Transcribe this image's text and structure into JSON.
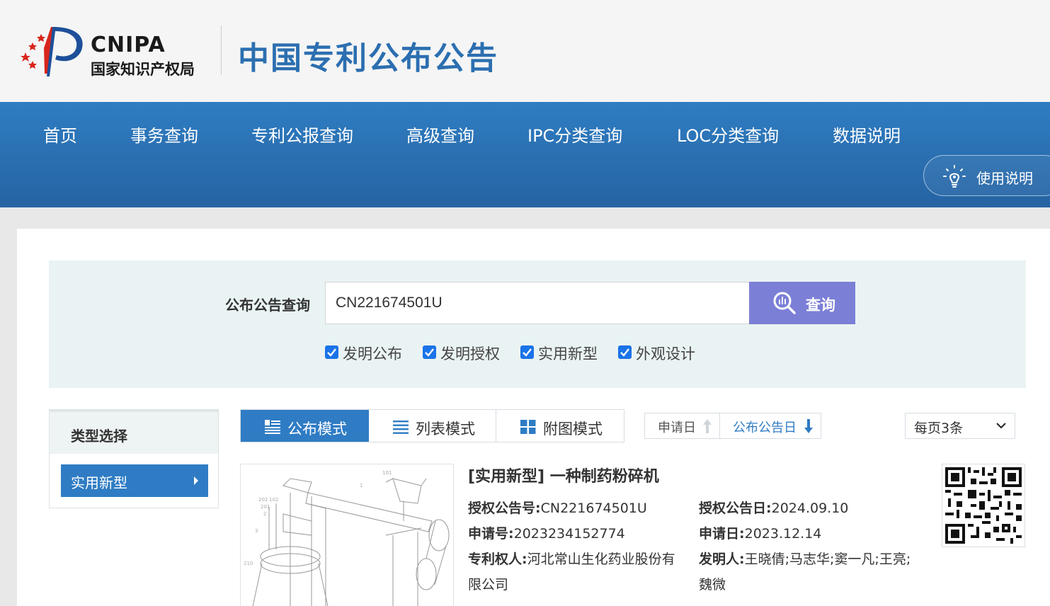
{
  "header": {
    "logo_en": "CNIPA",
    "logo_cn": "国家知识产权局",
    "site_title": "中国专利公布公告"
  },
  "nav": {
    "items": [
      {
        "label": "首页"
      },
      {
        "label": "事务查询"
      },
      {
        "label": "专利公报查询"
      },
      {
        "label": "高级查询"
      },
      {
        "label": "IPC分类查询"
      },
      {
        "label": "LOC分类查询"
      },
      {
        "label": "数据说明"
      }
    ],
    "help_label": "使用说明",
    "help_icon": "lightbulb-icon"
  },
  "search": {
    "label": "公布公告查询",
    "value": "CN221674501U",
    "button_label": "查询",
    "button_icon": "search-icon",
    "filters": [
      {
        "label": "发明公布",
        "checked": true
      },
      {
        "label": "发明授权",
        "checked": true
      },
      {
        "label": "实用新型",
        "checked": true
      },
      {
        "label": "外观设计",
        "checked": true
      }
    ]
  },
  "sidebar": {
    "title": "类型选择",
    "items": [
      {
        "label": "实用新型"
      }
    ]
  },
  "toolbar": {
    "tabs": [
      {
        "label": "公布模式",
        "icon": "publish-mode-icon",
        "active": true
      },
      {
        "label": "列表模式",
        "icon": "list-icon",
        "active": false
      },
      {
        "label": "附图模式",
        "icon": "grid-icon",
        "active": false
      }
    ],
    "sort": [
      {
        "label": "申请日",
        "direction": "up",
        "active": false
      },
      {
        "label": "公布公告日",
        "direction": "down",
        "active": true
      }
    ],
    "per_page": "每页3条"
  },
  "result": {
    "title": "[实用新型] 一种制药粉碎机",
    "grant_no_label": "授权公告号:",
    "grant_no": "CN221674501U",
    "grant_date_label": "授权公告日:",
    "grant_date": "2024.09.10",
    "app_no_label": "申请号:",
    "app_no": "2023234152774",
    "app_date_label": "申请日:",
    "app_date": "2023.12.14",
    "patentee_label": "专利权人:",
    "patentee_line1": "河北常山生化药业股份有",
    "patentee_line2": "限公司",
    "inventor_label": "发明人:",
    "inventor_line1": "王晓倩;马志华;窦一凡;王亮;",
    "inventor_line2": "魏微"
  },
  "colors": {
    "brand_blue": "#2f7cc4",
    "title_blue": "#2c6fb0",
    "search_button": "#7b7fd6",
    "checkbox": "#1a73e8"
  }
}
